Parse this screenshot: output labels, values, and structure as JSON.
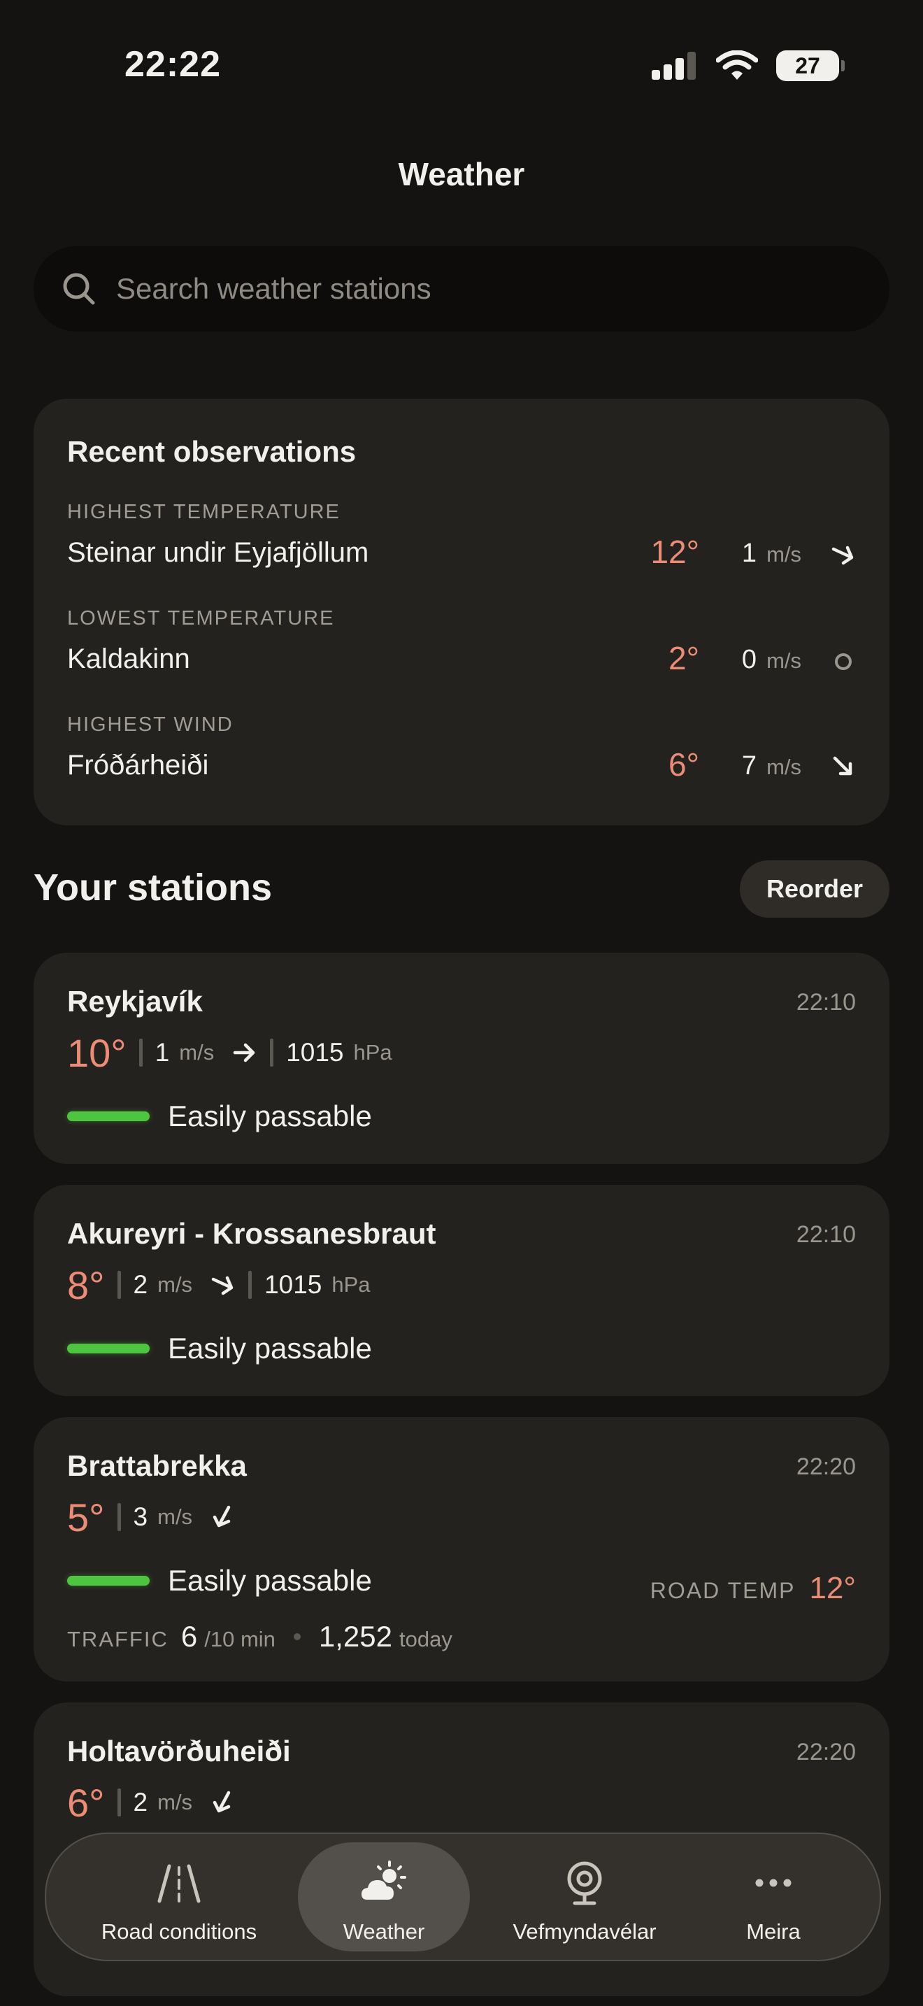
{
  "status_bar": {
    "time": "22:22",
    "battery": "27"
  },
  "header": {
    "title": "Weather"
  },
  "search": {
    "placeholder": "Search weather stations"
  },
  "recent": {
    "title": "Recent observations",
    "items": [
      {
        "label": "HIGHEST TEMPERATURE",
        "station": "Steinar undir Eyjafjöllum",
        "temp": "12°",
        "wind": "1",
        "unit": "m/s",
        "direction": "arrow-right-down"
      },
      {
        "label": "LOWEST TEMPERATURE",
        "station": "Kaldakinn",
        "temp": "2°",
        "wind": "0",
        "unit": "m/s",
        "direction": "calm-circle"
      },
      {
        "label": "HIGHEST WIND",
        "station": "Fróðárheiði",
        "temp": "6°",
        "wind": "7",
        "unit": "m/s",
        "direction": "arrow-down-right"
      }
    ]
  },
  "stations_header": {
    "title": "Your stations",
    "reorder_label": "Reorder"
  },
  "stations": [
    {
      "name": "Reykjavík",
      "time": "22:10",
      "temp": "10°",
      "wind": "1",
      "wind_unit": "m/s",
      "direction": "arrow-right",
      "pressure": "1015",
      "pressure_unit": "hPa",
      "condition": "Easily passable",
      "condition_color": "#4dc53f"
    },
    {
      "name": "Akureyri - Krossanesbraut",
      "time": "22:10",
      "temp": "8°",
      "wind": "2",
      "wind_unit": "m/s",
      "direction": "arrow-down-right",
      "pressure": "1015",
      "pressure_unit": "hPa",
      "condition": "Easily passable",
      "condition_color": "#4dc53f"
    },
    {
      "name": "Brattabrekka",
      "time": "22:20",
      "temp": "5°",
      "wind": "3",
      "wind_unit": "m/s",
      "direction": "arrow-down-left",
      "condition": "Easily passable",
      "condition_color": "#4dc53f",
      "road_temp_label": "ROAD TEMP",
      "road_temp": "12°",
      "traffic_label": "TRAFFIC",
      "traffic_rate": "6",
      "traffic_rate_unit": "/10 min",
      "traffic_today": "1,252",
      "traffic_today_unit": "today"
    },
    {
      "name": "Holtavörðuheiði",
      "time": "22:20",
      "temp": "6°",
      "wind": "2",
      "wind_unit": "m/s",
      "direction": "arrow-down-left"
    }
  ],
  "tabbar": {
    "items": [
      {
        "label": "Road conditions",
        "icon": "road-icon"
      },
      {
        "label": "Weather",
        "icon": "cloud-sun-icon",
        "active": true
      },
      {
        "label": "Vefmyndavélar",
        "icon": "webcam-icon"
      },
      {
        "label": "Meira",
        "icon": "more-icon"
      }
    ]
  },
  "colors": {
    "background": "#141311",
    "card": "#24221f",
    "temperature": "#ec8b76",
    "passable": "#4dc53f"
  }
}
